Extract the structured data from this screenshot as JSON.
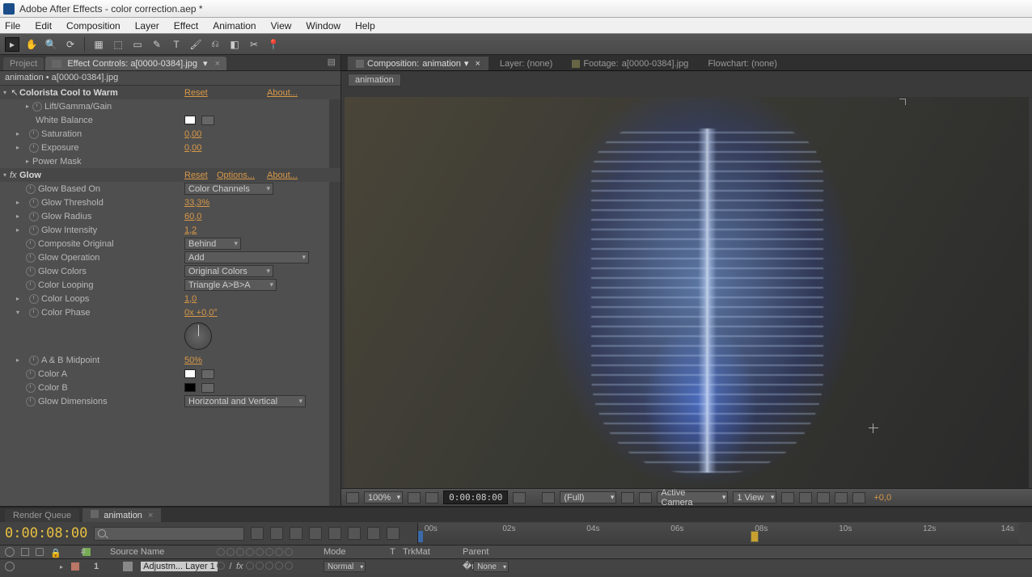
{
  "titlebar": {
    "app": "Adobe After Effects",
    "file": "color correction.aep *"
  },
  "menu": [
    "File",
    "Edit",
    "Composition",
    "Layer",
    "Effect",
    "Animation",
    "View",
    "Window",
    "Help"
  ],
  "leftTabs": {
    "project": "Project",
    "effect_prefix": "Effect Controls: ",
    "effect_target": "a[0000-0384].jpg"
  },
  "breadcrumb": "animation • a[0000-0384].jpg",
  "effects": {
    "colorista": {
      "name": "Colorista Cool to Warm",
      "reset": "Reset",
      "about": "About...",
      "lift": "Lift/Gamma/Gain",
      "wb": "White Balance",
      "sat_label": "Saturation",
      "sat_val": "0,00",
      "exp_label": "Exposure",
      "exp_val": "0,00",
      "power": "Power Mask"
    },
    "glow": {
      "name": "Glow",
      "reset": "Reset",
      "options": "Options...",
      "about": "About...",
      "based_label": "Glow Based On",
      "based_val": "Color Channels",
      "thresh_label": "Glow Threshold",
      "thresh_val": "33,3%",
      "radius_label": "Glow Radius",
      "radius_val": "60,0",
      "inten_label": "Glow Intensity",
      "inten_val": "1,2",
      "compo_label": "Composite Original",
      "compo_val": "Behind",
      "op_label": "Glow Operation",
      "op_val": "Add",
      "colors_label": "Glow Colors",
      "colors_val": "Original Colors",
      "loop_label": "Color Looping",
      "loop_val": "Triangle A>B>A",
      "loops_label": "Color Loops",
      "loops_val": "1,0",
      "phase_label": "Color Phase",
      "phase_val": "0x +0,0°",
      "mid_label": "A & B Midpoint",
      "mid_val": "50%",
      "a_label": "Color A",
      "b_label": "Color B",
      "dim_label": "Glow Dimensions",
      "dim_val": "Horizontal and Vertical"
    }
  },
  "compTabs": {
    "comp_prefix": "Composition: ",
    "comp_name": "animation",
    "layer": "Layer: (none)",
    "footage_prefix": "Footage: ",
    "footage_name": "a[0000-0384].jpg",
    "flow": "Flowchart: (none)",
    "sub": "animation"
  },
  "viewerFooter": {
    "zoom": "100%",
    "time": "0:00:08:00",
    "res": "(Full)",
    "camera": "Active Camera",
    "view": "1 View",
    "exp": "+0,0"
  },
  "bottom": {
    "render": "Render Queue",
    "comp": "animation",
    "timecode": "0:00:08:00",
    "ticks": [
      "00s",
      "02s",
      "04s",
      "06s",
      "08s",
      "10s",
      "12s",
      "14s"
    ],
    "marker_pos_pct": 56,
    "cols": {
      "hash": "#",
      "src": "Source Name",
      "mode": "Mode",
      "t": "T",
      "trk": "TrkMat",
      "parent": "Parent"
    },
    "layer": {
      "num": "1",
      "name": "Adjustm... Layer 1",
      "mode": "Normal",
      "parent": "None"
    }
  }
}
